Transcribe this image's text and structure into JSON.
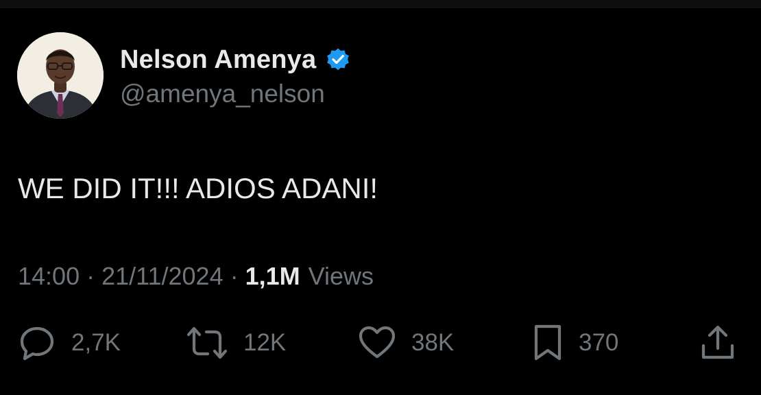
{
  "author": {
    "display_name": "Nelson Amenya",
    "handle": "@amenya_nelson",
    "verified": true
  },
  "tweet": {
    "text": "WE DID IT!!! ADIOS ADANI!"
  },
  "meta": {
    "time": "14:00",
    "separator": "·",
    "date": "21/11/2024",
    "views_count": "1,1M",
    "views_label": "Views"
  },
  "actions": {
    "replies": "2,7K",
    "reposts": "12K",
    "likes": "38K",
    "bookmarks": "370"
  },
  "icons": {
    "reply": "reply-icon",
    "repost": "repost-icon",
    "like": "heart-icon",
    "bookmark": "bookmark-icon",
    "share": "share-icon",
    "verified": "verified-badge-icon"
  },
  "colors": {
    "background": "#000000",
    "primary_text": "#e7e9ea",
    "secondary_text": "#71767b",
    "verified_blue": "#1d9bf0"
  }
}
